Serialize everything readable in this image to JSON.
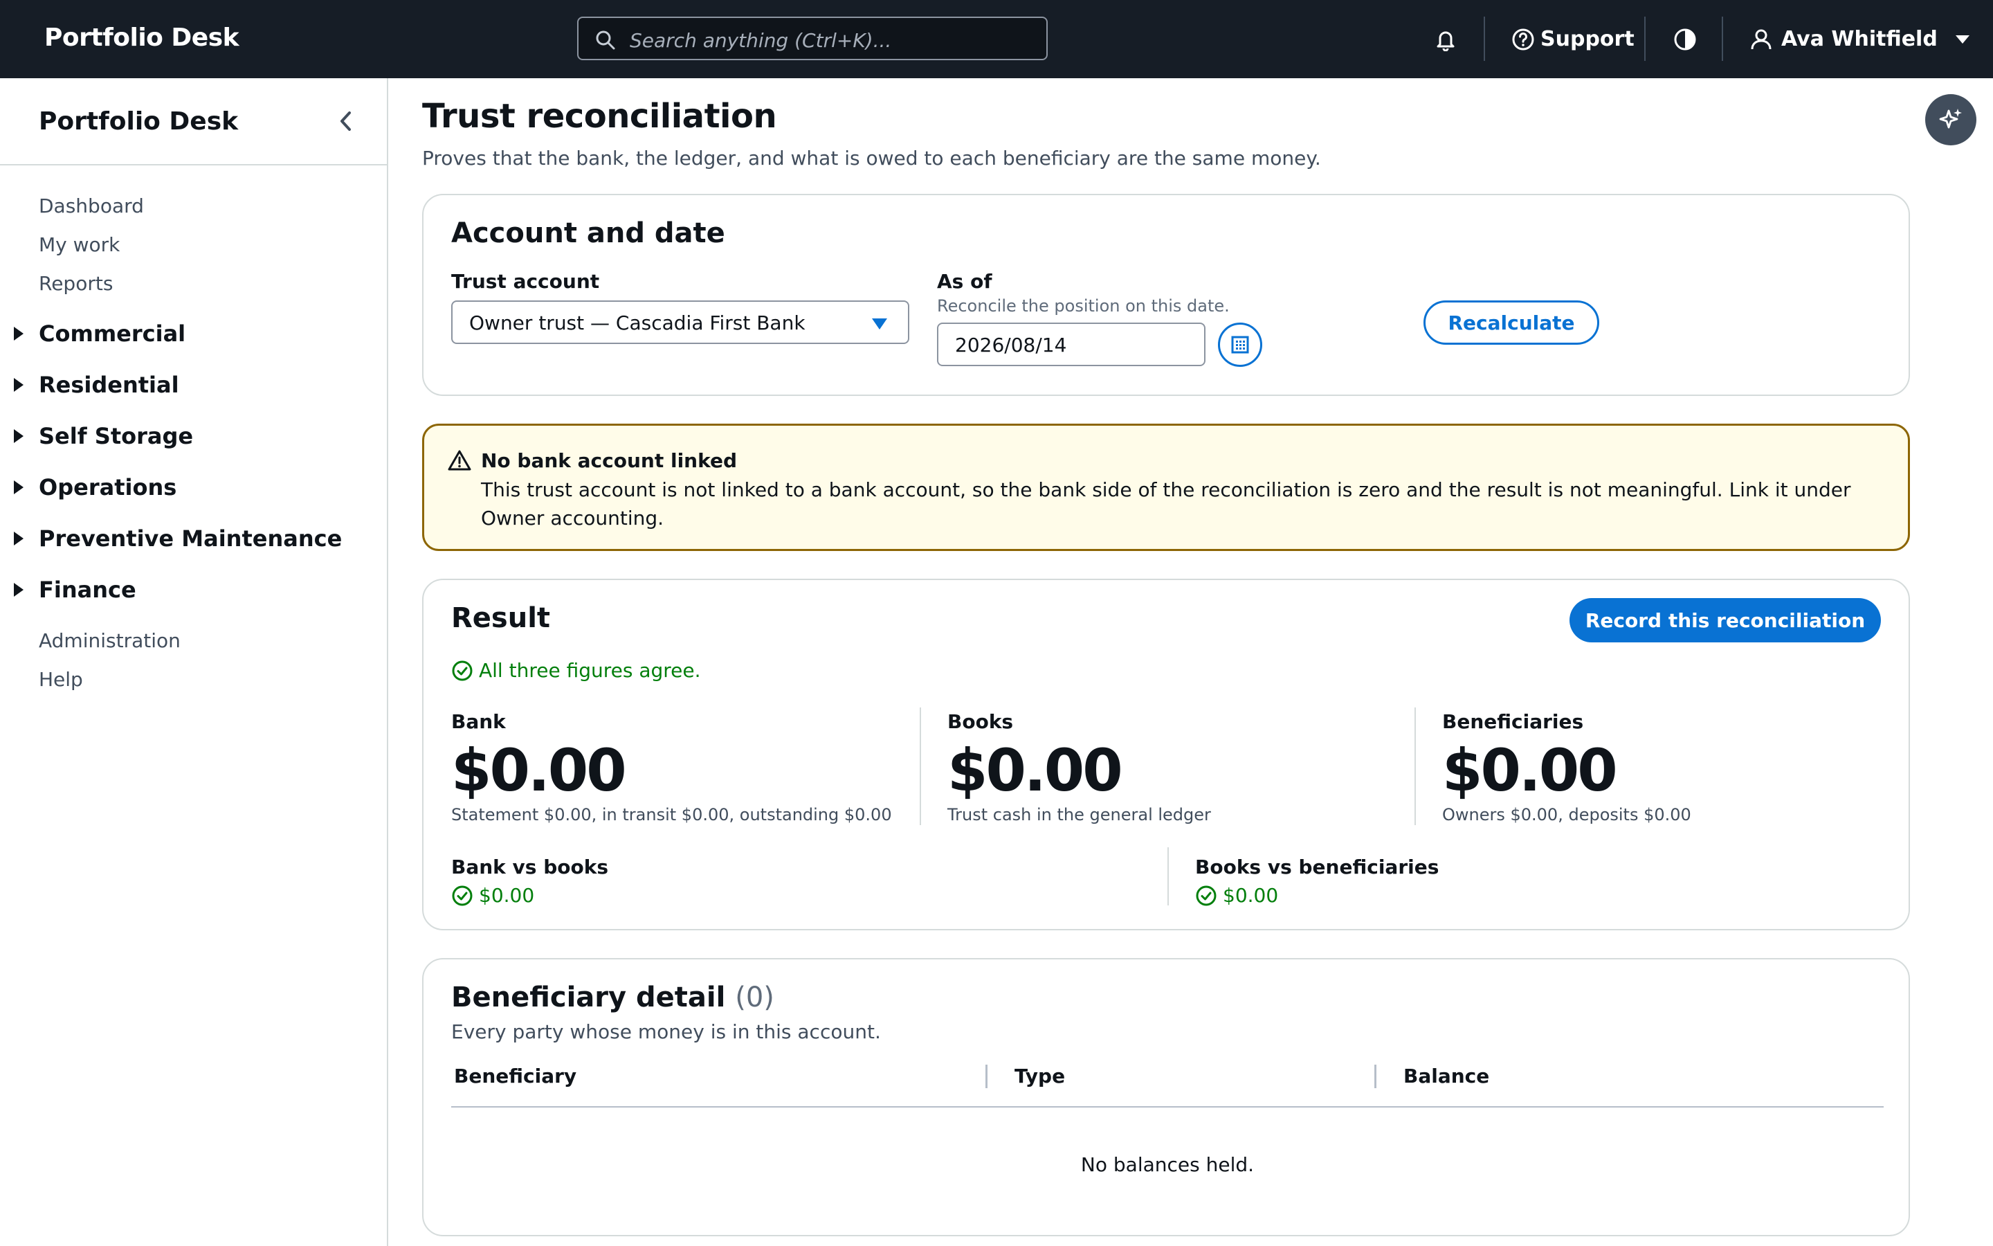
{
  "topbar": {
    "brand": "Portfolio Desk",
    "search_placeholder": "Search anything (Ctrl+K)...",
    "support_label": "Support",
    "user_name": "Ava Whitfield"
  },
  "sidenav": {
    "title": "Portfolio Desk",
    "top_links": [
      "Dashboard",
      "My work",
      "Reports"
    ],
    "groups": [
      "Commercial",
      "Residential",
      "Self Storage",
      "Operations",
      "Preventive Maintenance",
      "Finance"
    ],
    "bottom_links": [
      "Administration",
      "Help"
    ]
  },
  "page": {
    "title": "Trust reconciliation",
    "description": "Proves that the bank, the ledger, and what is owed to each beneficiary are the same money."
  },
  "account_card": {
    "heading": "Account and date",
    "trust_account_label": "Trust account",
    "trust_account_value": "Owner trust — Cascadia First Bank",
    "as_of_label": "As of",
    "as_of_hint": "Reconcile the position on this date.",
    "as_of_value": "2026/08/14",
    "recalculate_label": "Recalculate"
  },
  "alert": {
    "title": "No bank account linked",
    "body": "This trust account is not linked to a bank account, so the bank side of the reconciliation is zero and the result is not meaningful. Link it under Owner accounting."
  },
  "result": {
    "heading": "Result",
    "record_label": "Record this reconciliation",
    "status": "All three figures agree.",
    "bank": {
      "label": "Bank",
      "value": "$0.00",
      "desc": "Statement $0.00, in transit $0.00, outstanding $0.00"
    },
    "books": {
      "label": "Books",
      "value": "$0.00",
      "desc": "Trust cash in the general ledger"
    },
    "beneficiaries": {
      "label": "Beneficiaries",
      "value": "$0.00",
      "desc": "Owners $0.00, deposits $0.00"
    },
    "bank_vs_books": {
      "label": "Bank vs books",
      "value": "$0.00"
    },
    "books_vs_beneficiaries": {
      "label": "Books vs beneficiaries",
      "value": "$0.00"
    }
  },
  "beneficiary_detail": {
    "heading": "Beneficiary detail",
    "count": "(0)",
    "description": "Every party whose money is in this account.",
    "columns": [
      "Beneficiary",
      "Type",
      "Balance"
    ],
    "empty_text": "No balances held."
  },
  "colors": {
    "topbar_bg": "#161d26",
    "accent": "#0972d3",
    "success": "#037f0c",
    "warning_border": "#8d6605",
    "warning_bg": "#fffce9"
  }
}
